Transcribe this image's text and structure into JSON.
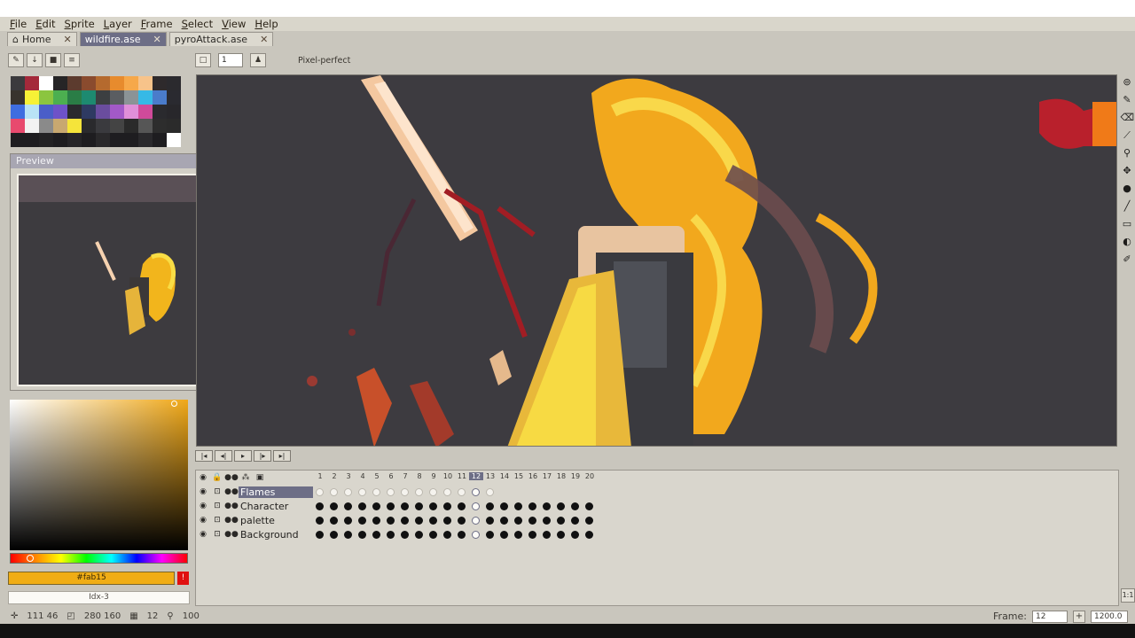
{
  "menubar": {
    "items": [
      "File",
      "Edit",
      "Sprite",
      "Layer",
      "Frame",
      "Select",
      "View",
      "Help"
    ]
  },
  "tabs": [
    {
      "label": "Home",
      "icon": "home-icon"
    },
    {
      "label": "wildfire.ase",
      "active": true
    },
    {
      "label": "pyroAttack.ase"
    }
  ],
  "tab_close": "✕",
  "tool_options": {
    "brush_size": "1",
    "pixel_perfect_label": "Pixel-perfect"
  },
  "palette": {
    "colors": [
      "#3b3a3d",
      "#a4293a",
      "#ffffff",
      "#262526",
      "#5c3b2e",
      "#8a4b2e",
      "#b56a2e",
      "#e78b2d",
      "#f6a84a",
      "#f7c38a",
      "#2e2a2c",
      "#2b2a2e",
      "#38332d",
      "#f7f136",
      "#8bc53f",
      "#4caf50",
      "#2a7d46",
      "#1d8a70",
      "#3c3f41",
      "#5a5d61",
      "#8b9396",
      "#36b9e6",
      "#4a7ccb",
      "#2a2a30",
      "#3e6de0",
      "#b9e3f6",
      "#4a5ec8",
      "#6e52c8",
      "#2a2a2e",
      "#2e3a62",
      "#6a4d9e",
      "#a359c8",
      "#e08fd8",
      "#d04a9a",
      "#2a2a2e",
      "#28272b",
      "#e84a6e",
      "#f2f2f2",
      "#8a8a8a",
      "#c8a870",
      "#f5e43a",
      "#2a2a2d",
      "#3a3a3e",
      "#444",
      "#2a2a2a",
      "#565656",
      "#2d2d2d",
      "#2b2b2b",
      "#1e1d20",
      "#1e1d20",
      "#232224",
      "#1e1d20",
      "#262528",
      "#1e1d20",
      "#2a292b",
      "#1e1d20",
      "#1e1d20",
      "#2a292c",
      "#1e1d20",
      "#ffffff"
    ]
  },
  "preview": {
    "title": "Preview"
  },
  "color": {
    "hex": "#fab15",
    "index": "Idx-3",
    "accent": "#f0ad15"
  },
  "timeline": {
    "frames": [
      "1",
      "2",
      "3",
      "4",
      "5",
      "6",
      "7",
      "8",
      "9",
      "10",
      "11",
      "12",
      "13",
      "14",
      "15",
      "16",
      "17",
      "18",
      "19",
      "20"
    ],
    "current_frame_index": 11,
    "layers": [
      {
        "name": "Flames",
        "selected": true
      },
      {
        "name": "Character"
      },
      {
        "name": "palette"
      },
      {
        "name": "Background"
      }
    ]
  },
  "status": {
    "cursor": "111 46",
    "size": "280 160",
    "frame": "12",
    "zoom": "100"
  },
  "frame_control": {
    "label": "Frame:",
    "value": "12",
    "duration": "1200.0",
    "add_icon": "+"
  },
  "zoom_fit": "1:1"
}
